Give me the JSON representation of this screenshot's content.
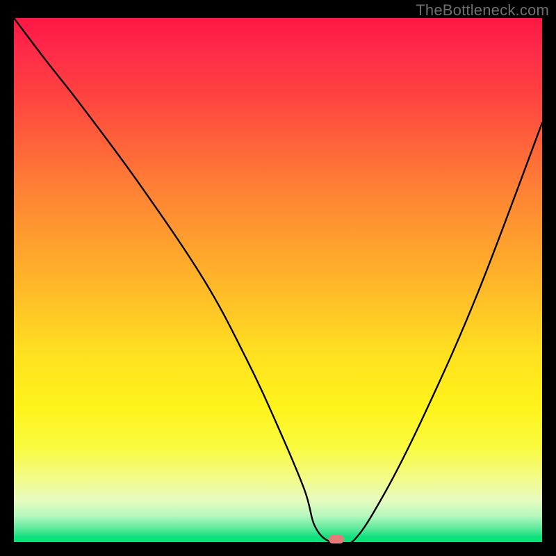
{
  "watermark": "TheBottleneck.com",
  "colors": {
    "background": "#000000",
    "curve": "#000000",
    "marker": "#e67a7a",
    "gradient_top": "#ff1744",
    "gradient_mid": "#ffe020",
    "gradient_bottom": "#00e676",
    "watermark_text": "#6f6f6f"
  },
  "chart_data": {
    "type": "line",
    "title": "",
    "xlabel": "",
    "ylabel": "",
    "xlim": [
      0,
      100
    ],
    "ylim": [
      0,
      100
    ],
    "grid": false,
    "legend": false,
    "description": "Bottleneck curve over red-to-green vertical gradient; valley near x≈61 at y≈0; small pink marker at trough.",
    "series": [
      {
        "name": "bottleneck-curve",
        "x": [
          0,
          6,
          13,
          24,
          36,
          44,
          50,
          55,
          57,
          60,
          64,
          70,
          78,
          88,
          100
        ],
        "values": [
          100,
          92,
          83,
          68,
          50,
          35,
          22,
          10,
          3,
          0,
          0,
          9,
          25,
          48,
          80
        ]
      }
    ],
    "marker": {
      "x": 61,
      "y": 0.5
    },
    "gradient_stops": [
      {
        "pos": 0,
        "color": "#ff1744"
      },
      {
        "pos": 0.14,
        "color": "#ff4040"
      },
      {
        "pos": 0.34,
        "color": "#ff8534"
      },
      {
        "pos": 0.54,
        "color": "#ffc127"
      },
      {
        "pos": 0.74,
        "color": "#fff31a"
      },
      {
        "pos": 0.92,
        "color": "#e7fbbe"
      },
      {
        "pos": 1.0,
        "color": "#00e676"
      }
    ]
  }
}
